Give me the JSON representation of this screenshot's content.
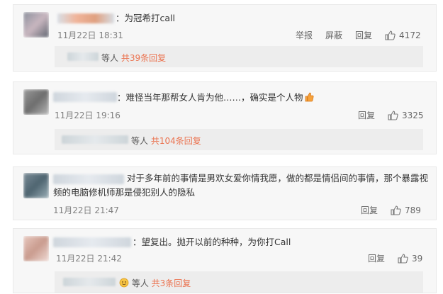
{
  "comments": [
    {
      "text": "：为冠希打call",
      "time": "11月22日 18:31",
      "actions": [
        "举报",
        "屏蔽",
        "回复"
      ],
      "likes": "4172",
      "replies_prefix": "等人",
      "replies_count": "共39条回复"
    },
    {
      "text": "：难怪当年那帮女人肯为他……，确实是个人物",
      "time": "11月22日 19:16",
      "actions": [
        "回复"
      ],
      "likes": "3325",
      "replies_prefix": "等人",
      "replies_count": "共104条回复"
    },
    {
      "text_line1": "对于多年前的事情是男欢女爱你情我愿，做的都是情侣间的事情，那个暴露视",
      "text_line2": "频的电脑修机师那是侵犯别人的隐私",
      "time": "11月22日 21:47",
      "actions": [
        "回复"
      ],
      "likes": "789"
    },
    {
      "text": "：望复出。抛开以前的种种，为你打Call",
      "time": "11月22日 21:42",
      "actions": [
        "回复"
      ],
      "likes": "39",
      "replies_prefix": "等人",
      "replies_count": "共3条回复"
    }
  ],
  "icons": {
    "like": "thumbs-up-icon",
    "emoji": "thumbs-up-emoji-icon"
  },
  "colors": {
    "card_bg": "#f7f7f7",
    "reply_bg": "#ededed",
    "accent": "#eb7350",
    "muted": "#808080"
  }
}
